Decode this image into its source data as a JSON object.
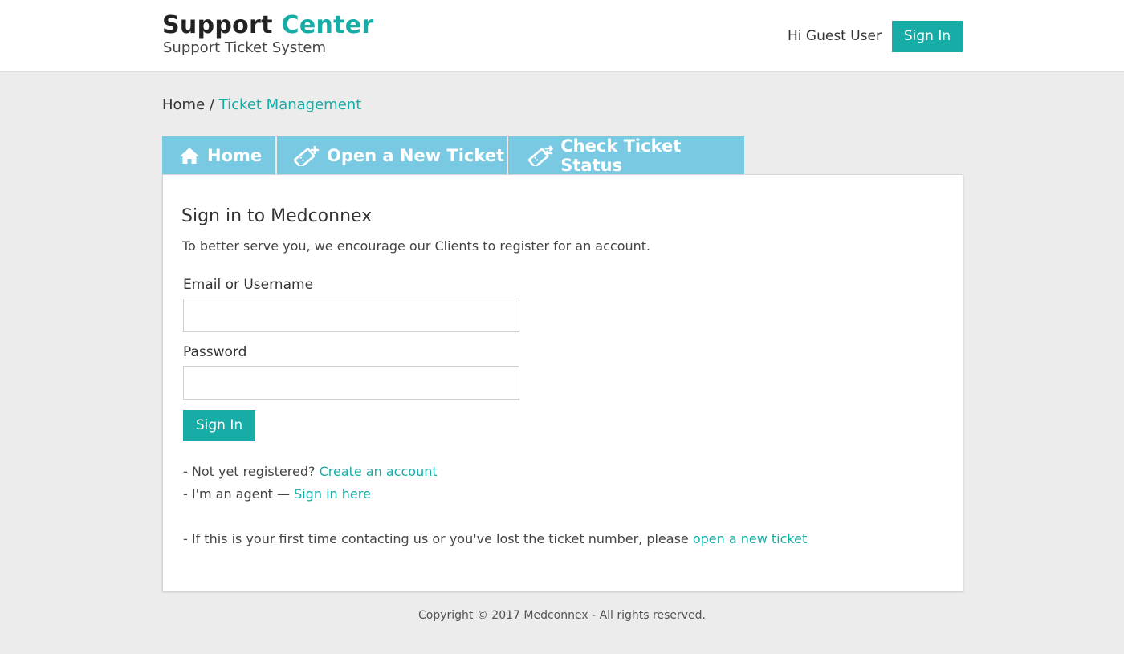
{
  "header": {
    "brand_main": "Support",
    "brand_accent": "Center",
    "brand_subtitle": "Support Ticket System",
    "greeting": "Hi Guest User",
    "signin_label": "Sign In"
  },
  "breadcrumb": {
    "home": "Home",
    "separator": "/",
    "current": "Ticket Management"
  },
  "tabs": [
    {
      "label": "Home",
      "icon": "home-icon"
    },
    {
      "label": "Open a New Ticket",
      "icon": "ticket-plus-icon"
    },
    {
      "label": "Check Ticket Status",
      "icon": "ticket-check-icon"
    }
  ],
  "signin_form": {
    "title": "Sign in to Medconnex",
    "intro": "To better serve you, we encourage our Clients to register for an account.",
    "email_label": "Email or Username",
    "email_value": "",
    "password_label": "Password",
    "password_value": "",
    "submit_label": "Sign In"
  },
  "notes": {
    "register_prefix": "- Not yet registered?",
    "register_link": "Create an account",
    "agent_prefix": "- I'm an agent —",
    "agent_link": "Sign in here",
    "first_time_prefix": "- If this is your first time contacting us or you've lost the ticket number, please",
    "first_time_link": "open a new ticket"
  },
  "footer": {
    "copyright": "Copyright © 2017 Medconnex - All rights reserved."
  },
  "colors": {
    "accent": "#17aca5",
    "tab_background": "#7ac9e3",
    "page_background": "#ececec"
  }
}
